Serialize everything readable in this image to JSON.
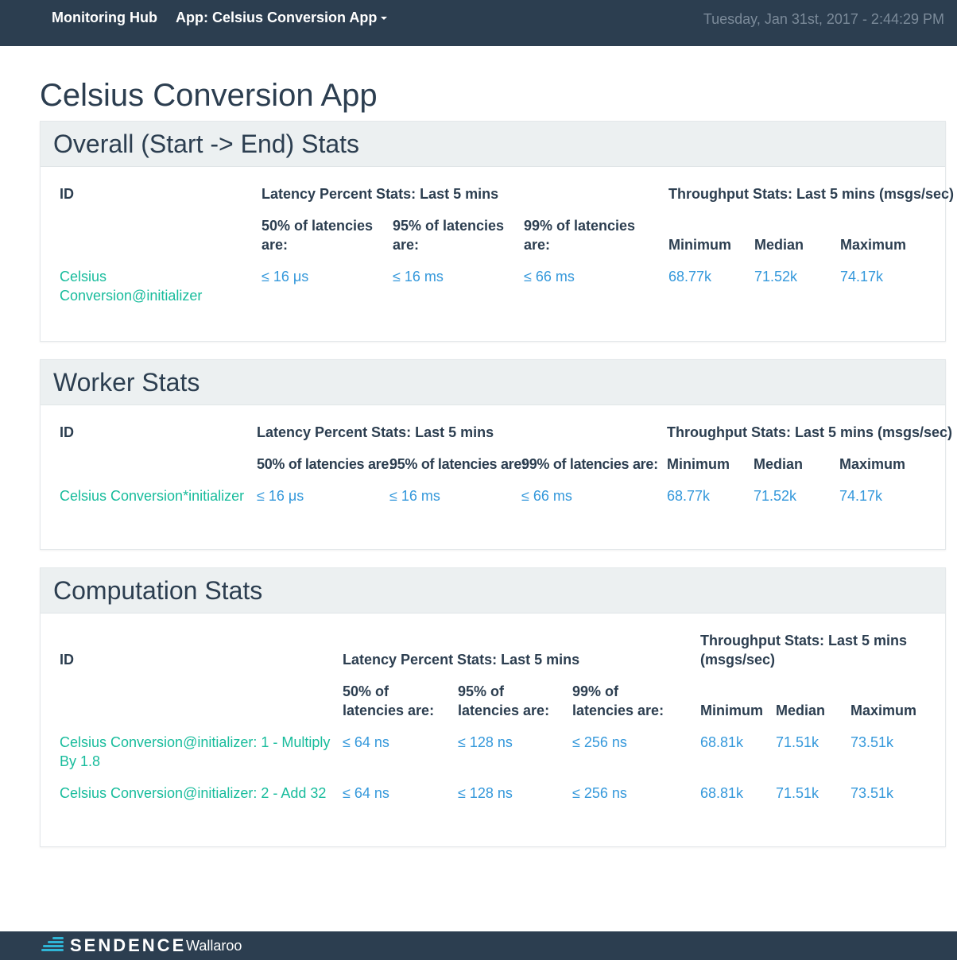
{
  "navbar": {
    "brand": "Monitoring Hub",
    "app_menu": "App: Celsius Conversion App",
    "timestamp": "Tuesday, Jan 31st, 2017 - 2:44:29 PM"
  },
  "page_title": "Celsius Conversion App",
  "overall": {
    "title": "Overall (Start -> End) Stats",
    "headers": {
      "id": "ID",
      "latency": "Latency Percent Stats: Last 5 mins",
      "throughput": "Throughput Stats: Last 5 mins (msgs/sec)",
      "p50": "50% of latencies are:",
      "p95": "95% of latencies are:",
      "p99": "99% of latencies are:",
      "min": "Minimum",
      "median": "Median",
      "max": "Maximum"
    },
    "rows": [
      {
        "id": "Celsius Conversion@initializer",
        "p50": "≤ 16 μs",
        "p95": "≤ 16 ms",
        "p99": "≤ 66 ms",
        "min": "68.77k",
        "median": "71.52k",
        "max": "74.17k"
      }
    ]
  },
  "worker": {
    "title": "Worker Stats",
    "headers": {
      "id": "ID",
      "latency": "Latency Percent Stats: Last 5 mins",
      "throughput": "Throughput Stats: Last 5 mins (msgs/sec)",
      "p50": "50% of latencies are:",
      "p95": "95% of latencies are:",
      "p99": "99% of latencies are:",
      "min": "Minimum",
      "median": "Median",
      "max": "Maximum"
    },
    "rows": [
      {
        "id": "Celsius Conversion*initializer",
        "p50": "≤ 16 μs",
        "p95": "≤ 16 ms",
        "p99": "≤ 66 ms",
        "min": "68.77k",
        "median": "71.52k",
        "max": "74.17k"
      }
    ]
  },
  "computation": {
    "title": "Computation Stats",
    "headers": {
      "id": "ID",
      "latency": "Latency Percent Stats: Last 5 mins",
      "throughput": "Throughput Stats: Last 5 mins (msgs/sec)",
      "p50": "50% of latencies are:",
      "p95": "95% of latencies are:",
      "p99": "99% of latencies are:",
      "min": "Minimum",
      "median": "Median",
      "max": "Maximum"
    },
    "rows": [
      {
        "id": "Celsius Conversion@initializer: 1 - Multiply By 1.8",
        "p50": "≤ 64 ns",
        "p95": "≤ 128 ns",
        "p99": "≤ 256 ns",
        "min": "68.81k",
        "median": "71.51k",
        "max": "73.51k"
      },
      {
        "id": "Celsius Conversion@initializer: 2 - Add 32",
        "p50": "≤ 64 ns",
        "p95": "≤ 128 ns",
        "p99": "≤ 256 ns",
        "min": "68.81k",
        "median": "71.51k",
        "max": "73.51k"
      }
    ]
  },
  "footer": {
    "logo_text": "SENDENCE",
    "product": "Wallaroo"
  }
}
